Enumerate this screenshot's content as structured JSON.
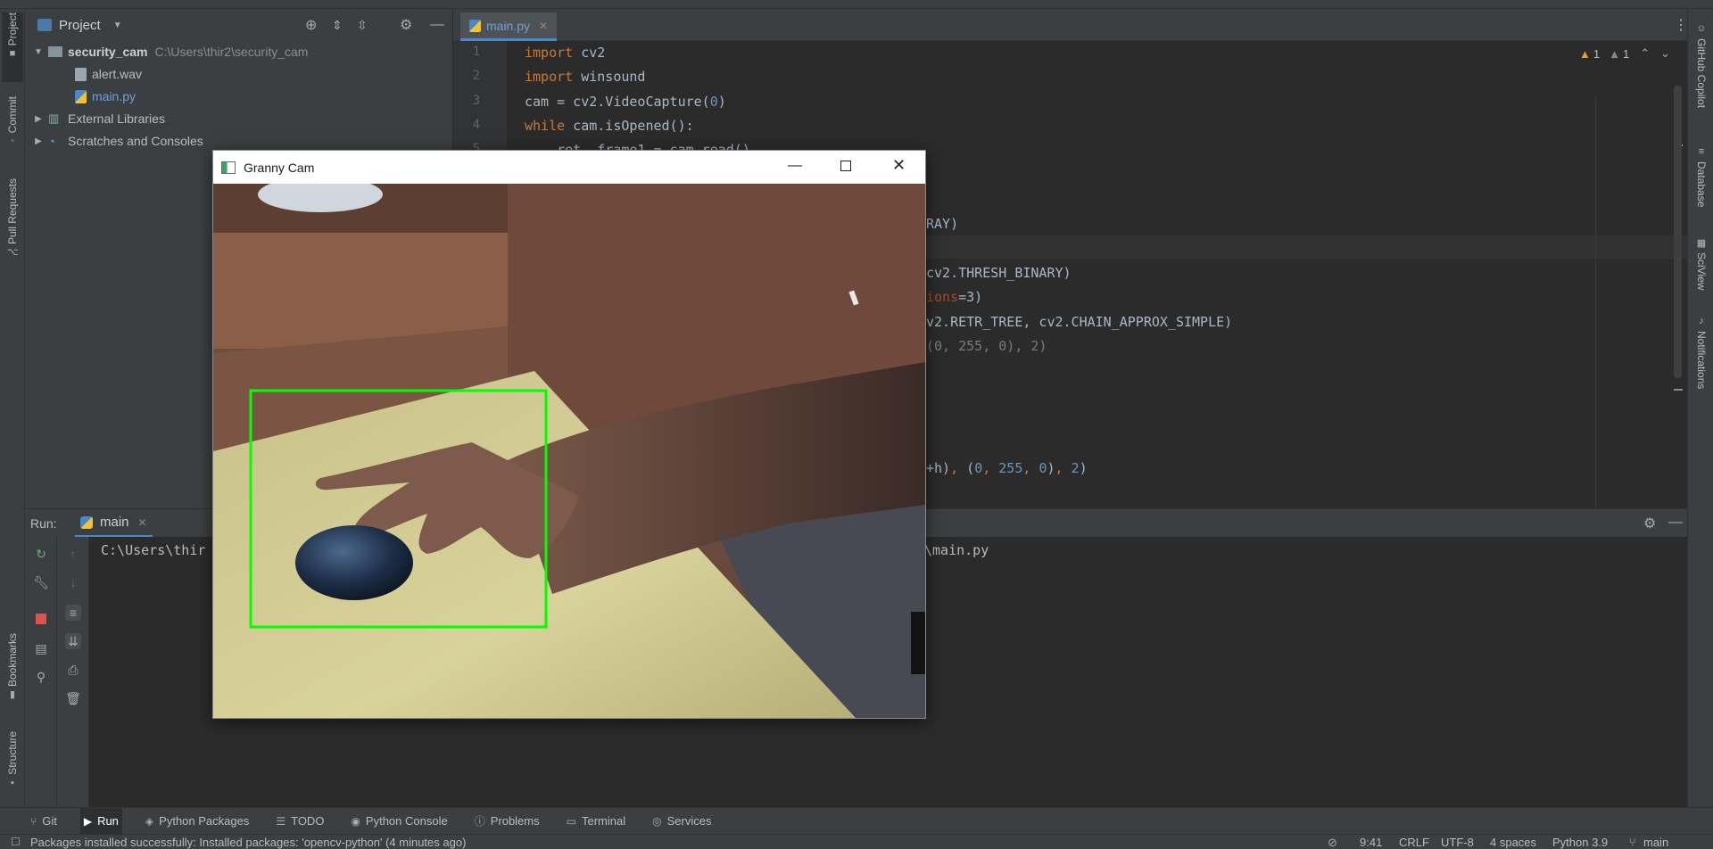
{
  "project_panel": {
    "title": "Project",
    "tree": [
      {
        "label": "security_cam",
        "path": "C:\\Users\\thir2\\security_cam"
      },
      {
        "label": "alert.wav"
      },
      {
        "label": "main.py"
      },
      {
        "label": "External Libraries"
      },
      {
        "label": "Scratches and Consoles"
      }
    ]
  },
  "left_strip": {
    "tabs": [
      "Project",
      "Commit",
      "Pull Requests",
      "Bookmarks",
      "Structure"
    ]
  },
  "right_strip": {
    "tabs": [
      "GitHub Copilot",
      "Database",
      "SciView",
      "Notifications"
    ]
  },
  "editor": {
    "tab_label": "main.py",
    "inspections": {
      "warnings": "1",
      "weak_warnings": "1"
    },
    "line_numbers": [
      "1",
      "2",
      "3",
      "4",
      "5"
    ],
    "lines": [
      {
        "kw": "import",
        "rest": " cv2"
      },
      {
        "kw": "import",
        "rest": " winsound"
      },
      {
        "pre": "cam = cv2.VideoCapture(",
        "num": "0",
        "post": ")"
      },
      {
        "kw": "while",
        "rest": " cam.isOpened():"
      },
      {
        "rest": "    ret, frame1 = cam.read()"
      }
    ],
    "visible_fragments": {
      "f1": "RAY)",
      "f2": "cv2.THRESH_BINARY)",
      "f3_param": "ions",
      "f3_rest": "=3)",
      "f4": "v2.RETR_TREE, cv2.CHAIN_APPROX_SIMPLE)",
      "f5": "(0, 255, 0), 2)",
      "f6_a": "+h)",
      "f6_b": "(",
      "f6_n1": "0",
      "f6_n2": "255",
      "f6_n3": "0",
      "f6_n4": "2"
    }
  },
  "run_panel": {
    "label": "Run:",
    "tab": "main",
    "console_left": "C:\\Users\\thir",
    "console_right": "\\main.py"
  },
  "cam_window": {
    "title": "Granny Cam",
    "detection_box_color": "#00ff00"
  },
  "bottom_tabs": [
    {
      "label": "Git",
      "icon": "git-branch-icon"
    },
    {
      "label": "Run",
      "icon": "run-icon"
    },
    {
      "label": "Python Packages",
      "icon": "packages-icon"
    },
    {
      "label": "TODO",
      "icon": "todo-icon"
    },
    {
      "label": "Python Console",
      "icon": "python-console-icon"
    },
    {
      "label": "Problems",
      "icon": "problems-icon"
    },
    {
      "label": "Terminal",
      "icon": "terminal-icon"
    },
    {
      "label": "Services",
      "icon": "services-icon"
    }
  ],
  "status_bar": {
    "message": "Packages installed successfully: Installed packages: 'opencv-python' (4 minutes ago)",
    "position": "9:41",
    "line_sep": "CRLF",
    "encoding": "UTF-8",
    "indent": "4 spaces",
    "interpreter": "Python 3.9",
    "branch": "main"
  }
}
